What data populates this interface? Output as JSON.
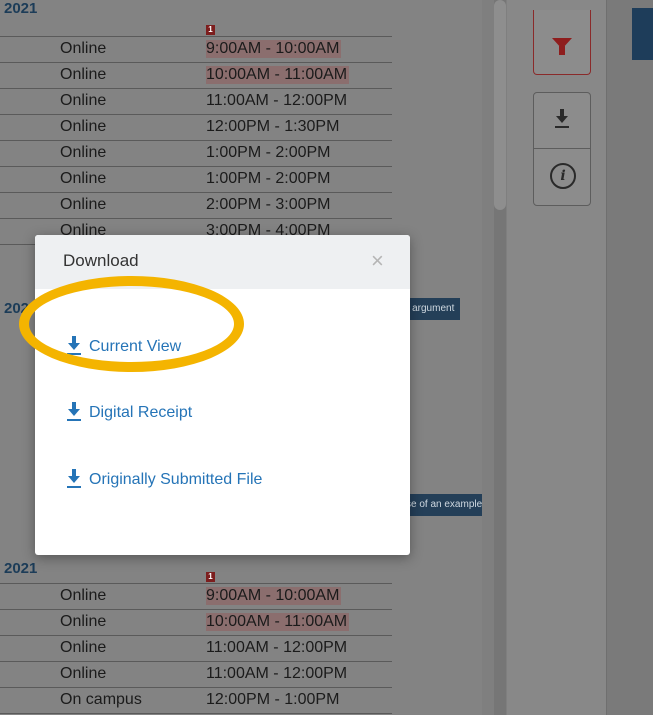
{
  "schedule": {
    "year_label": "2021",
    "top_rows": [
      {
        "mode": "Online",
        "time": "9:00AM - 10:00AM",
        "highlight": true,
        "marker": true
      },
      {
        "mode": "Online",
        "time": "10:00AM - 11:00AM",
        "highlight": true,
        "marker": false
      },
      {
        "mode": "Online",
        "time": "11:00AM - 12:00PM",
        "highlight": false,
        "marker": false
      },
      {
        "mode": "Online",
        "time": "12:00PM - 1:30PM",
        "highlight": false,
        "marker": false
      },
      {
        "mode": "Online",
        "time": "1:00PM - 2:00PM",
        "highlight": false,
        "marker": false
      },
      {
        "mode": "Online",
        "time": "1:00PM - 2:00PM",
        "highlight": false,
        "marker": false
      },
      {
        "mode": "Online",
        "time": "2:00PM - 3:00PM",
        "highlight": false,
        "marker": false
      },
      {
        "mode": "Online",
        "time": "3:00PM - 4:00PM",
        "highlight": false,
        "marker": false
      }
    ],
    "mid_year_label": "202",
    "bottom_year_label": "2021",
    "bottom_rows": [
      {
        "mode": "Online",
        "time": "9:00AM - 10:00AM",
        "highlight": true,
        "marker": true
      },
      {
        "mode": "Online",
        "time": "10:00AM - 11:00AM",
        "highlight": true,
        "marker": false
      },
      {
        "mode": "Online",
        "time": "11:00AM - 12:00PM",
        "highlight": false,
        "marker": false
      },
      {
        "mode": "Online",
        "time": "11:00AM - 12:00PM",
        "highlight": false,
        "marker": false
      },
      {
        "mode": "On campus",
        "time": "12:00PM - 1:00PM",
        "highlight": false,
        "marker": false
      }
    ],
    "marker_label": "1",
    "note_tags": [
      "- argument",
      "se of an example"
    ]
  },
  "toolbar": {
    "filter_icon": "funnel-icon",
    "download_icon": "download-icon",
    "info_icon": "info-icon",
    "info_glyph": "i",
    "accent_color": "#8e1d1d"
  },
  "modal": {
    "title": "Download",
    "close_glyph": "×",
    "options": [
      {
        "label": "Current View",
        "icon": "download-icon"
      },
      {
        "label": "Digital Receipt",
        "icon": "download-icon"
      },
      {
        "label": "Originally Submitted File",
        "icon": "download-icon"
      }
    ],
    "link_color": "#2574b7",
    "highlight_color": "#f4b400"
  }
}
